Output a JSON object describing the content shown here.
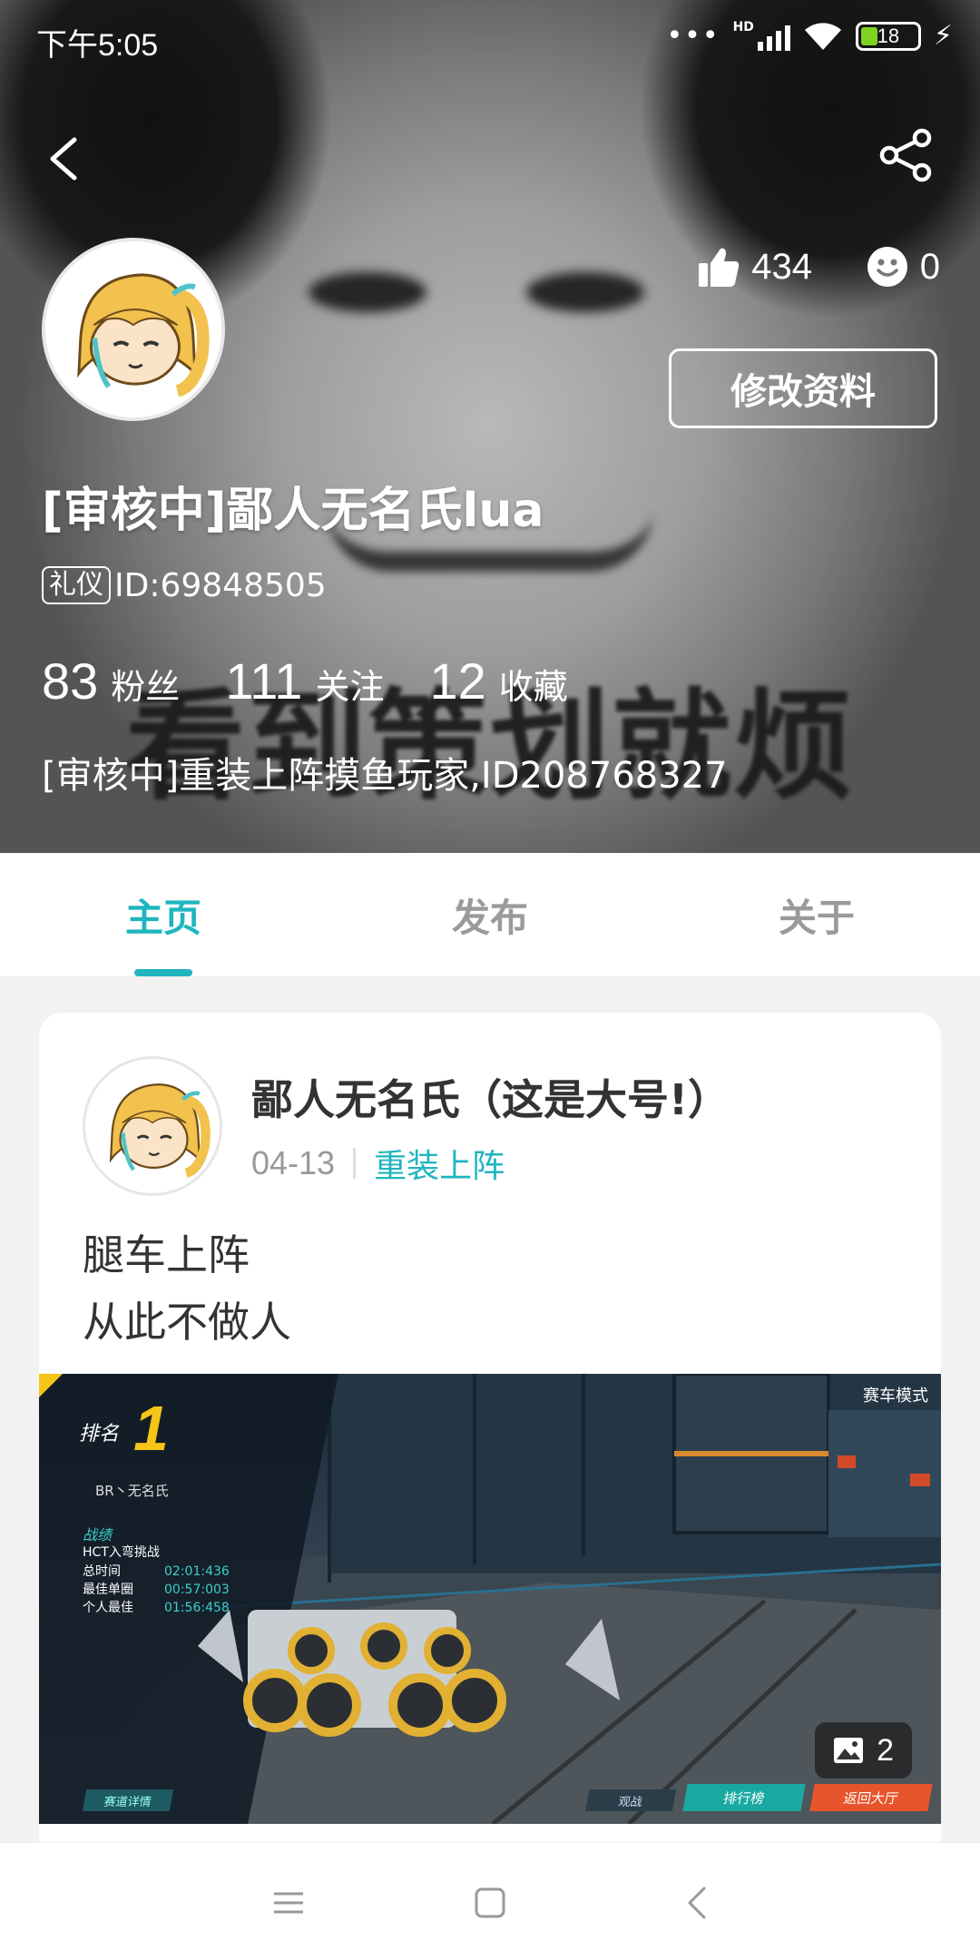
{
  "status_bar": {
    "time": "下午5:05",
    "network": "HD",
    "battery_level": "18"
  },
  "profile": {
    "avatar_icon": "anime-girl-avatar",
    "likes": "434",
    "smiles": "0",
    "edit_button": "修改资料",
    "username": "[审核中]鄙人无名氏lua",
    "badge": "礼仪",
    "id_text": "ID:69848505",
    "stats": [
      {
        "value": "83",
        "label": "粉丝"
      },
      {
        "value": "111",
        "label": "关注"
      },
      {
        "value": "12",
        "label": "收藏"
      }
    ],
    "bio": "[审核中]重装上阵摸鱼玩家,ID208768327",
    "banner_text": "看到策划就烦"
  },
  "tabs": [
    {
      "label": "主页",
      "active": true
    },
    {
      "label": "发布",
      "active": false
    },
    {
      "label": "关于",
      "active": false
    }
  ],
  "post": {
    "author": "鄙人无名氏（这是大号!）",
    "date": "04-13",
    "category": "重装上阵",
    "body_lines": [
      "腿车上阵",
      "从此不做人"
    ],
    "image_count": "2",
    "game_screenshot": {
      "mode": "赛车模式",
      "rank_label": "排名",
      "rank": "1",
      "player": "BR丶无名氏",
      "record_title": "战绩",
      "challenge": "HCT入弯挑战",
      "rows": [
        {
          "label": "总时间",
          "value": "02:01:436"
        },
        {
          "label": "最佳单圈",
          "value": "00:57:003"
        },
        {
          "label": "个人最佳",
          "value": "01:56:458"
        }
      ],
      "buttons": [
        "赛道详情",
        "观战",
        "排行榜",
        "返回大厅"
      ]
    }
  },
  "colors": {
    "accent": "#1fb5bf",
    "card_bg": "#ffffff",
    "page_bg": "#f2f2f2"
  }
}
